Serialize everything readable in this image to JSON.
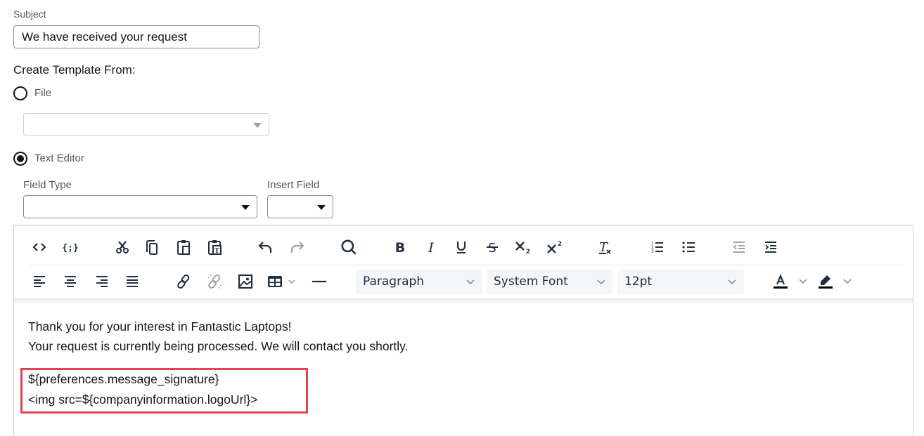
{
  "form": {
    "subject_label": "Subject",
    "subject_value": "We have received your request",
    "create_template_label": "Create Template From:",
    "radio_file_label": "File",
    "radio_file_checked": false,
    "file_select_value": "",
    "radio_text_editor_label": "Text Editor",
    "radio_text_editor_checked": true,
    "field_type_label": "Field Type",
    "field_type_value": "",
    "insert_field_label": "Insert Field",
    "insert_field_value": ""
  },
  "toolbar": {
    "row1": [
      {
        "name": "source-code",
        "icon": "code-icon",
        "enabled": true
      },
      {
        "name": "template-variable",
        "icon": "curly-braces-icon",
        "enabled": true
      },
      {
        "name": "cut",
        "icon": "scissors-icon",
        "enabled": true
      },
      {
        "name": "copy",
        "icon": "copy-icon",
        "enabled": true
      },
      {
        "name": "paste",
        "icon": "paste-icon",
        "enabled": true
      },
      {
        "name": "paste-as-text",
        "icon": "paste-text-icon",
        "enabled": true
      },
      {
        "name": "undo",
        "icon": "undo-icon",
        "enabled": true
      },
      {
        "name": "redo",
        "icon": "redo-icon",
        "enabled": false
      },
      {
        "name": "find-replace",
        "icon": "search-icon",
        "enabled": true
      },
      {
        "name": "bold",
        "icon": "bold-icon",
        "enabled": true
      },
      {
        "name": "italic",
        "icon": "italic-icon",
        "enabled": true
      },
      {
        "name": "underline",
        "icon": "underline-icon",
        "enabled": true
      },
      {
        "name": "strikethrough",
        "icon": "strikethrough-icon",
        "enabled": true
      },
      {
        "name": "subscript",
        "icon": "subscript-icon",
        "enabled": true
      },
      {
        "name": "superscript",
        "icon": "superscript-icon",
        "enabled": true
      },
      {
        "name": "clear-formatting",
        "icon": "remove-format-icon",
        "enabled": true
      },
      {
        "name": "numbered-list",
        "icon": "ordered-list-icon",
        "enabled": true
      },
      {
        "name": "bullet-list",
        "icon": "unordered-list-icon",
        "enabled": true
      },
      {
        "name": "decrease-indent",
        "icon": "outdent-icon",
        "enabled": false
      },
      {
        "name": "increase-indent",
        "icon": "indent-icon",
        "enabled": true
      }
    ],
    "row2": [
      {
        "name": "align-left",
        "icon": "align-left-icon",
        "enabled": true
      },
      {
        "name": "align-center",
        "icon": "align-center-icon",
        "enabled": true
      },
      {
        "name": "align-right",
        "icon": "align-right-icon",
        "enabled": true
      },
      {
        "name": "align-justify",
        "icon": "align-justify-icon",
        "enabled": true
      },
      {
        "name": "insert-link",
        "icon": "link-icon",
        "enabled": true
      },
      {
        "name": "remove-link",
        "icon": "unlink-icon",
        "enabled": false
      },
      {
        "name": "insert-image",
        "icon": "image-icon",
        "enabled": true
      },
      {
        "name": "insert-table",
        "icon": "table-icon",
        "enabled": true
      },
      {
        "name": "horizontal-line",
        "icon": "horizontal-rule-icon",
        "enabled": true
      }
    ],
    "block_format": "Paragraph",
    "font_family": "System Font",
    "font_size": "12pt",
    "text_color_icon": "text-color-icon",
    "highlight_color_icon": "highlight-color-icon"
  },
  "editor_content": {
    "line1": "Thank you for your interest in Fantastic Laptops!",
    "line2": "Your request is currently being processed. We will contact you shortly.",
    "line3": "${preferences.message_signature}",
    "line4": "<img src=${companyinformation.logoUrl}>"
  },
  "colors": {
    "icon": "#222f3e",
    "icon_disabled": "#a0a4a9",
    "highlight_border": "#e0454f"
  }
}
